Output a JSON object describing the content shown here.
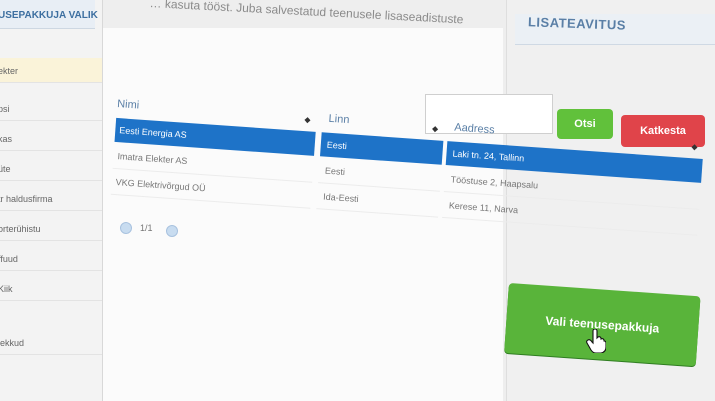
{
  "top_caption": "… kasuta tööst. Juba salvestatud teenusele lisaseadistuste",
  "left_panel": {
    "title": "USEPAKKUJA VALIK",
    "items": [
      "ekter",
      "psi",
      "kas",
      "üte",
      "tr haldusfirma",
      "orterühistu",
      "ffuud",
      "Kiik",
      "lekkud"
    ],
    "active_index": 0
  },
  "right_panel": {
    "title": "LISATEAVITUS"
  },
  "search": {
    "label": "Nimi",
    "value": "",
    "placeholder": ""
  },
  "buttons": {
    "otsi": "Otsi",
    "katkesta": "Katkesta",
    "vali": "Vali teenusepakkuja"
  },
  "table": {
    "columns": [
      "Nimi",
      "Linn",
      "Aadress"
    ],
    "rows": [
      {
        "nimi": "Eesti Energia AS",
        "linn": "Eesti",
        "aadress": "Laki tn. 24, Tallinn",
        "selected": true
      },
      {
        "nimi": "Imatra Elekter AS",
        "linn": "Eesti",
        "aadress": "Tööstuse 2, Haapsalu",
        "selected": false
      },
      {
        "nimi": "VKG Elektrivõrgud OÜ",
        "linn": "Ida-Eesti",
        "aadress": "Kerese 11, Narva",
        "selected": false
      }
    ]
  },
  "pager": {
    "text": "1/1"
  }
}
